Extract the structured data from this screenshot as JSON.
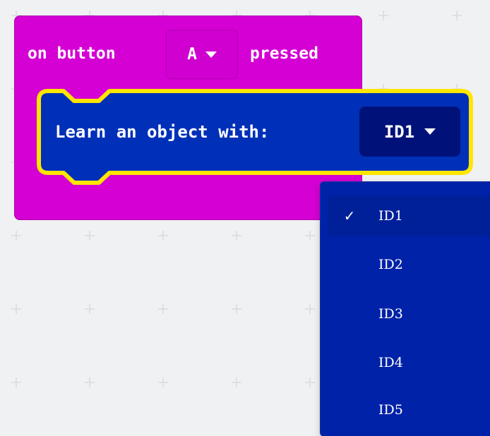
{
  "event_block": {
    "prefix": "on button",
    "button_value": "A",
    "suffix": "pressed",
    "color": "#d400d4"
  },
  "command_block": {
    "label": "Learn an object with:",
    "id_value": "ID1",
    "color": "#0030b8",
    "outline_color": "#ffe600"
  },
  "dropdown_menu": {
    "selected_check": "✓",
    "items": [
      {
        "label": "ID1"
      },
      {
        "label": "ID2"
      },
      {
        "label": "ID3"
      },
      {
        "label": "ID4"
      },
      {
        "label": "ID5"
      }
    ]
  }
}
